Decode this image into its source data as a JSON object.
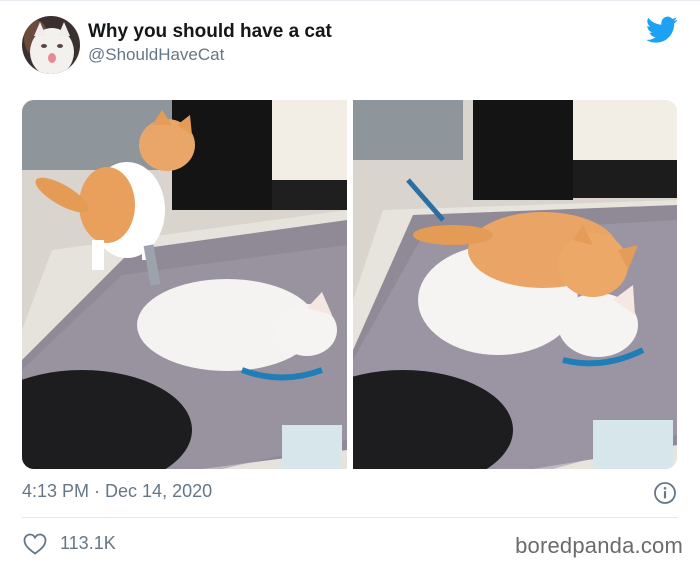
{
  "tweet": {
    "display_name": "Why you should have a cat",
    "handle": "@ShouldHaveCat",
    "timestamp": "4:13 PM · Dec 14, 2020",
    "likes": "113.1K"
  },
  "media": {
    "count": 2
  },
  "icons": {
    "brand": "twitter-bird-icon",
    "info": "info-icon",
    "like": "heart-icon"
  },
  "colors": {
    "twitter_blue": "#1da1f2",
    "secondary_text": "#657786",
    "primary_text": "#14171a"
  },
  "watermark": "boredpanda.com"
}
